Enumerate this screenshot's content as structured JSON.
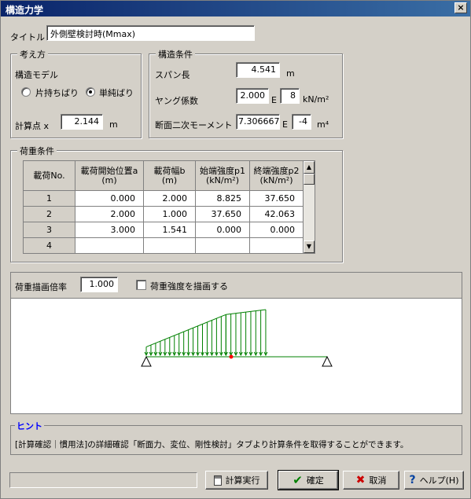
{
  "window": {
    "title": "構造力学",
    "close_glyph": "×"
  },
  "title_field": {
    "label": "タイトル",
    "value": "外側壁検討時(Mmax)"
  },
  "approach": {
    "group_title": "考え方",
    "model_label": "構造モデル",
    "options": [
      {
        "label": "片持ちばり",
        "selected": false
      },
      {
        "label": "単純ばり",
        "selected": true
      }
    ],
    "calc_point_label": "計算点 x",
    "calc_point_value": "2.144",
    "calc_point_unit": "m"
  },
  "structure": {
    "group_title": "構造条件",
    "span_label": "スパン長",
    "span_value": "4.541",
    "span_unit": "m",
    "young_label": "ヤング係数",
    "young_mantissa": "2.000",
    "young_e": "E",
    "young_exp": "8",
    "young_unit": "kN/m²",
    "moment_label": "断面二次モーメント",
    "moment_mantissa": "7.306667",
    "moment_e": "E",
    "moment_exp": "-4",
    "moment_unit": "m⁴"
  },
  "load": {
    "group_title": "荷重条件",
    "headers": [
      "載荷No.",
      "載荷開始位置a\n(m)",
      "載荷幅b\n(m)",
      "始端強度p1\n(kN/m²)",
      "終端強度p2\n(kN/m²)"
    ],
    "rows": [
      {
        "no": "1",
        "a": "0.000",
        "b": "2.000",
        "p1": "8.825",
        "p2": "37.650"
      },
      {
        "no": "2",
        "a": "2.000",
        "b": "1.000",
        "p1": "37.650",
        "p2": "42.063"
      },
      {
        "no": "3",
        "a": "3.000",
        "b": "1.541",
        "p1": "0.000",
        "p2": "0.000"
      },
      {
        "no": "4",
        "a": "",
        "b": "",
        "p1": "",
        "p2": ""
      }
    ],
    "scroll_up": "▲",
    "scroll_down": "▼"
  },
  "drawing": {
    "scale_label": "荷重描画倍率",
    "scale_value": "1.000",
    "draw_intensity_label": "荷重強度を描画する",
    "draw_intensity_checked": false
  },
  "hint": {
    "title": "ヒント",
    "text": "[計算確認｜慣用法]の詳細確認「断面力、変位、剛性検討」タブより計算条件を取得することができます。"
  },
  "buttons": {
    "calc": "計算実行",
    "ok": "確定",
    "cancel": "取消",
    "help": "ヘルプ(H)"
  },
  "colors": {
    "titlebar": "#0a246a",
    "load_line": "#008000",
    "point_marker": "#ff0000",
    "hint_title": "#0000ff"
  }
}
